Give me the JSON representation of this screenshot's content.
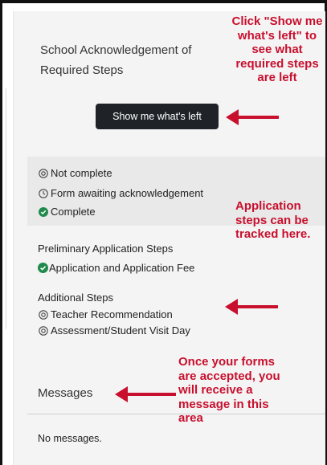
{
  "acknowledgement": {
    "title": "School Acknowledgement of Required Steps",
    "button_label": "Show me what's left"
  },
  "legend": {
    "not_complete": "Not complete",
    "awaiting": "Form awaiting acknowledgement",
    "complete": "Complete"
  },
  "preliminary": {
    "heading": "Preliminary Application Steps",
    "items": [
      "Application and Application Fee"
    ]
  },
  "additional": {
    "heading": "Additional Steps",
    "items": [
      "Teacher Recommendation",
      "Assessment/Student Visit Day"
    ]
  },
  "messages": {
    "title": "Messages",
    "empty_text": "No messages."
  },
  "annotations": {
    "show_button_note": "Click \"Show me what's left\" to see what required steps are left",
    "tracking_note": "Application steps can be tracked here.",
    "messages_note": "Once your forms are accepted, you will receive a message in this area"
  },
  "colors": {
    "annotation": "#c8102e",
    "complete_icon": "#1f8a4c",
    "button_bg": "#1f2327"
  },
  "icons": {
    "not_complete": "radio-target-icon",
    "awaiting": "clock-icon",
    "complete": "check-circle-icon"
  }
}
